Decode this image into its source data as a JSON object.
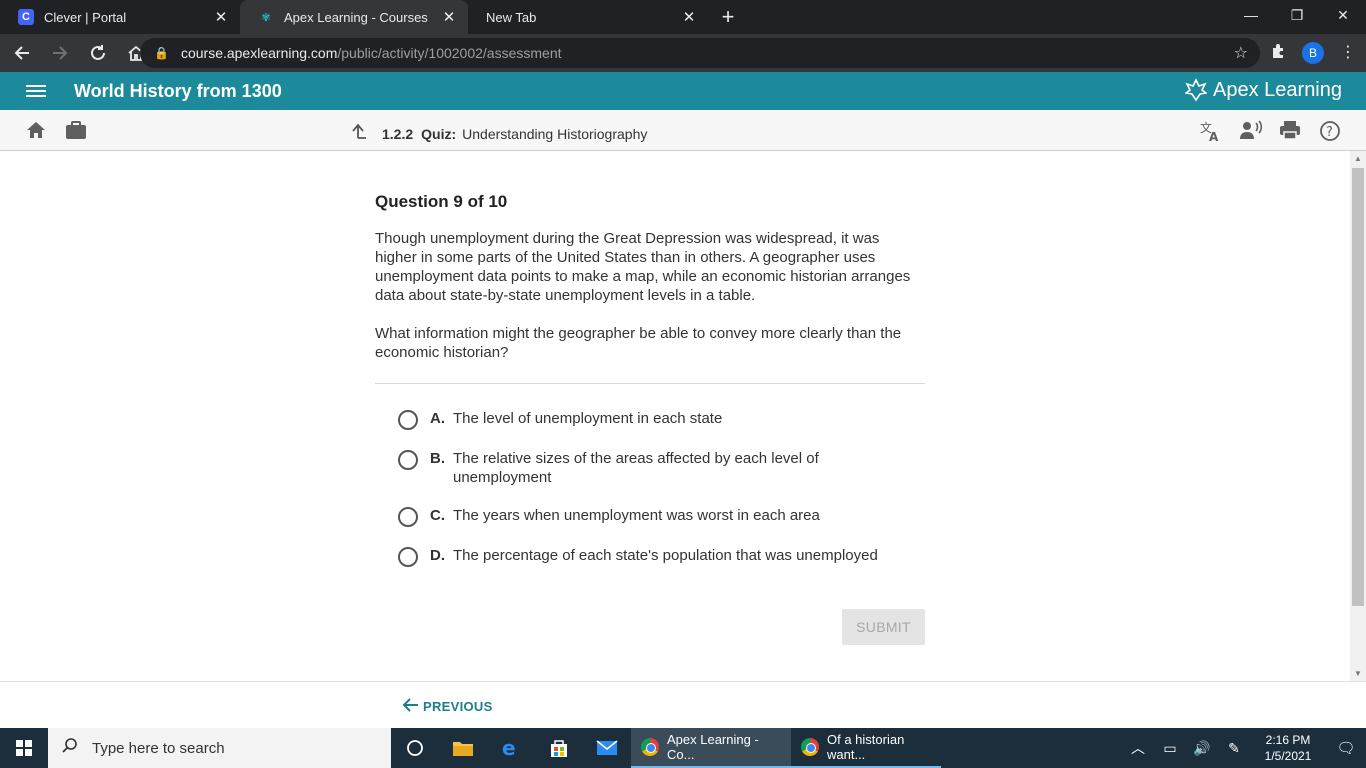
{
  "browser": {
    "tabs": [
      {
        "title": "Clever | Portal",
        "favicon": "C",
        "active": false
      },
      {
        "title": "Apex Learning - Courses",
        "favicon": "apex-icon",
        "active": true
      },
      {
        "title": "New Tab",
        "favicon": "",
        "active": false
      }
    ],
    "url_host": "course.apexlearning.com",
    "url_path": "/public/activity/1002002/assessment",
    "profile_initial": "B"
  },
  "app": {
    "course_title": "World History from 1300",
    "brand": "Apex Learning",
    "accent_color": "#1d8a9b"
  },
  "subbar": {
    "lesson_number": "1.2.2",
    "activity_type": "Quiz:",
    "activity_title": "Understanding Historiography"
  },
  "question": {
    "number_label": "Question 9 of 10",
    "paragraph1": "Though unemployment during the Great Depression was widespread, it was higher in some parts of the United States than in others. A geographer uses unemployment data points to make a map, while an economic historian arranges data about state-by-state unemployment levels in a table.",
    "paragraph2": "What information might the geographer be able to convey more clearly than the economic historian?",
    "options": [
      {
        "letter": "A.",
        "text": "The level of unemployment in each state"
      },
      {
        "letter": "B.",
        "text": "The relative sizes of the areas affected by each level of unemployment"
      },
      {
        "letter": "C.",
        "text": "The years when unemployment was worst in each area"
      },
      {
        "letter": "D.",
        "text": "The percentage of each state's population that was unemployed"
      }
    ],
    "submit_label": "SUBMIT"
  },
  "footer": {
    "previous_label": "PREVIOUS"
  },
  "taskbar": {
    "search_placeholder": "Type here to search",
    "apps": [
      {
        "title": "Apex Learning - Co...",
        "active": true
      },
      {
        "title": "Of a historian want...",
        "active": false
      }
    ],
    "time": "2:16 PM",
    "date": "1/5/2021"
  }
}
